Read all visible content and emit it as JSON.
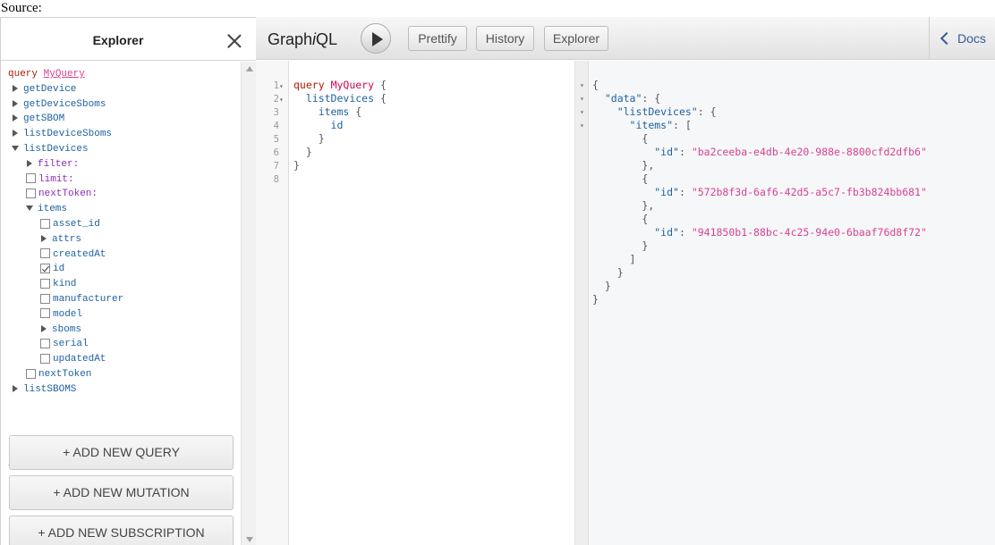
{
  "source_label": "Source:",
  "explorer": {
    "title": "Explorer",
    "operation_keyword": "query",
    "operation_name": "MyQuery",
    "tree": [
      {
        "type": "caret-right",
        "indent": 0,
        "label": "getDevice",
        "kind": "field"
      },
      {
        "type": "caret-right",
        "indent": 0,
        "label": "getDeviceSboms",
        "kind": "field"
      },
      {
        "type": "caret-right",
        "indent": 0,
        "label": "getSBOM",
        "kind": "field"
      },
      {
        "type": "caret-right",
        "indent": 0,
        "label": "listDeviceSboms",
        "kind": "field"
      },
      {
        "type": "caret-down",
        "indent": 0,
        "label": "listDevices",
        "kind": "field"
      },
      {
        "type": "caret-right",
        "indent": 1,
        "label": "filter:",
        "kind": "arg"
      },
      {
        "type": "checkbox",
        "indent": 1,
        "label": "limit:",
        "kind": "arg",
        "checked": false
      },
      {
        "type": "checkbox",
        "indent": 1,
        "label": "nextToken:",
        "kind": "arg",
        "checked": false
      },
      {
        "type": "caret-down",
        "indent": 1,
        "label": "items",
        "kind": "field"
      },
      {
        "type": "checkbox",
        "indent": 2,
        "label": "asset_id",
        "kind": "field",
        "checked": false
      },
      {
        "type": "caret-right",
        "indent": 2,
        "label": "attrs",
        "kind": "field"
      },
      {
        "type": "checkbox",
        "indent": 2,
        "label": "createdAt",
        "kind": "field",
        "checked": false
      },
      {
        "type": "checkbox",
        "indent": 2,
        "label": "id",
        "kind": "field",
        "checked": true
      },
      {
        "type": "checkbox",
        "indent": 2,
        "label": "kind",
        "kind": "field",
        "checked": false
      },
      {
        "type": "checkbox",
        "indent": 2,
        "label": "manufacturer",
        "kind": "field",
        "checked": false
      },
      {
        "type": "checkbox",
        "indent": 2,
        "label": "model",
        "kind": "field",
        "checked": false
      },
      {
        "type": "caret-right",
        "indent": 2,
        "label": "sboms",
        "kind": "field"
      },
      {
        "type": "checkbox",
        "indent": 2,
        "label": "serial",
        "kind": "field",
        "checked": false
      },
      {
        "type": "checkbox",
        "indent": 2,
        "label": "updatedAt",
        "kind": "field",
        "checked": false
      },
      {
        "type": "checkbox",
        "indent": 1,
        "label": "nextToken",
        "kind": "field",
        "checked": false
      },
      {
        "type": "caret-right",
        "indent": 0,
        "label": "listSBOMS",
        "kind": "field"
      }
    ],
    "buttons": {
      "add_query": "+ ADD NEW QUERY",
      "add_mutation": "+ ADD NEW MUTATION",
      "add_subscription": "+ ADD NEW SUBSCRIPTION"
    }
  },
  "toolbar": {
    "title_prefix": "Graph",
    "title_italic": "i",
    "title_suffix": "QL",
    "prettify": "Prettify",
    "history": "History",
    "explorer": "Explorer",
    "docs": "Docs"
  },
  "editor": {
    "lines": [
      {
        "n": "1",
        "fold": true
      },
      {
        "n": "2",
        "fold": true
      },
      {
        "n": "3",
        "fold": false
      },
      {
        "n": "4",
        "fold": false
      },
      {
        "n": "5",
        "fold": false
      },
      {
        "n": "6",
        "fold": false
      },
      {
        "n": "7",
        "fold": false
      },
      {
        "n": "8",
        "fold": false
      }
    ],
    "code": {
      "l1_kw": "query",
      "l1_name": "MyQuery",
      "l1_brace": "{",
      "l2": "listDevices",
      "l2_brace": "{",
      "l3": "items",
      "l3_brace": "{",
      "l4": "id",
      "l5": "}",
      "l6": "}",
      "l7": "}"
    }
  },
  "result": {
    "open_brace": "{",
    "data_key": "\"data\"",
    "list_key": "\"listDevices\"",
    "items_key": "\"items\"",
    "id_key": "\"id\"",
    "ids": [
      "\"ba2ceeba-e4db-4e20-988e-8800cfd2dfb6\"",
      "\"572b8f3d-6af6-42d5-a5c7-fb3b824bb681\"",
      "\"941850b1-88bc-4c25-94e0-6baaf76d8f72\""
    ]
  }
}
